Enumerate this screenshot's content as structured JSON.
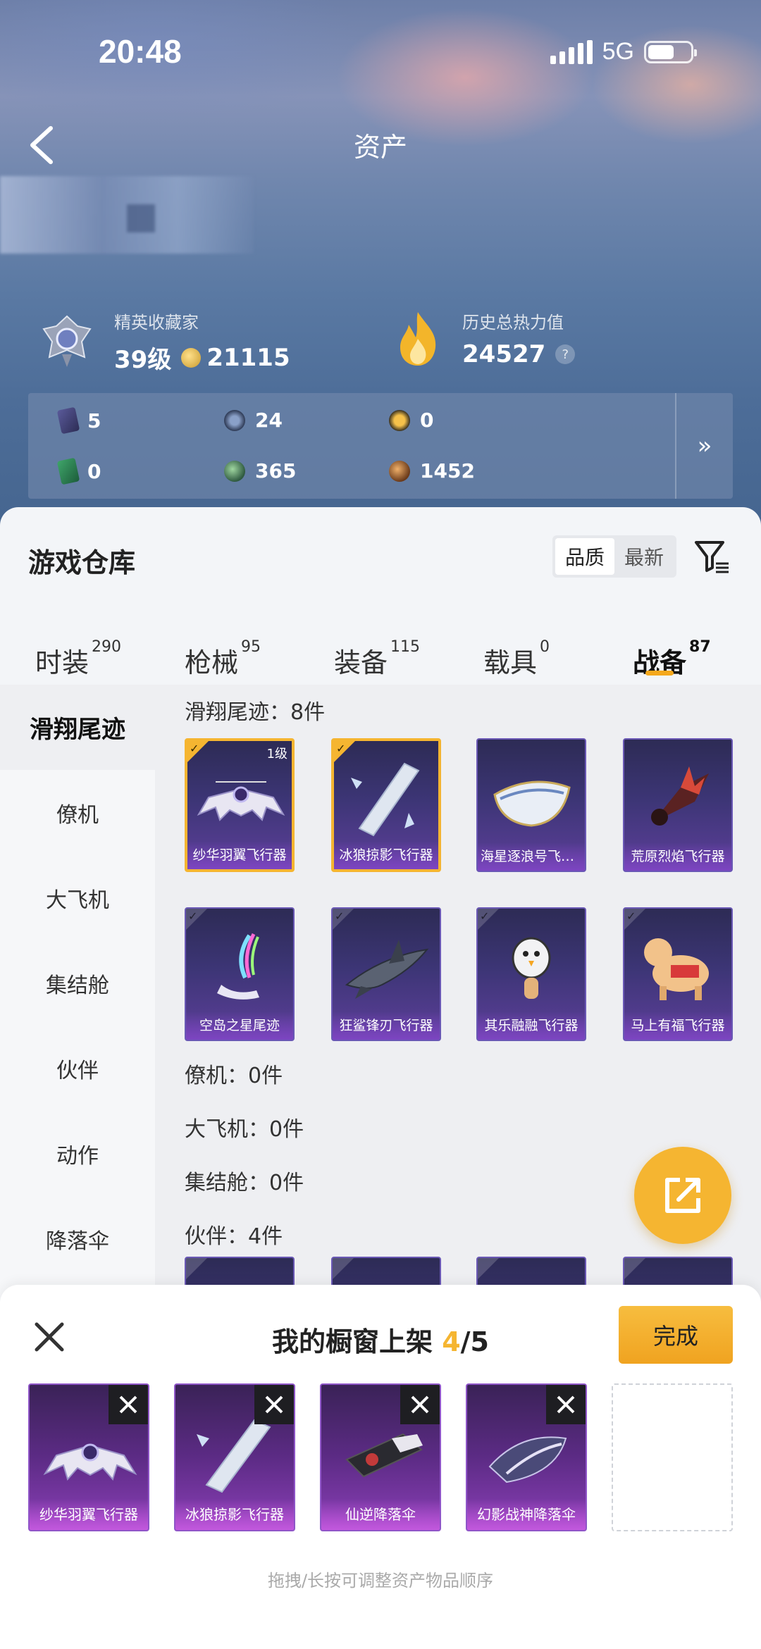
{
  "status_bar": {
    "time": "20:48",
    "network": "5G"
  },
  "header": {
    "title": "资产"
  },
  "profile": {
    "collector_label": "精英收藏家",
    "level": "39级",
    "coins": "21115",
    "power_label": "历史总热力值",
    "power_value": "24527",
    "help": "?"
  },
  "resources": {
    "row1": [
      "5",
      "24",
      "0"
    ],
    "row2": [
      "0",
      "365",
      "1452"
    ],
    "more": "»"
  },
  "warehouse": {
    "title": "游戏仓库",
    "sort_options": [
      "品质",
      "最新"
    ],
    "sort_selected": "品质",
    "tabs": [
      {
        "label": "时装",
        "count": "290"
      },
      {
        "label": "枪械",
        "count": "95"
      },
      {
        "label": "装备",
        "count": "115"
      },
      {
        "label": "载具",
        "count": "0"
      },
      {
        "label": "战备",
        "count": "87"
      }
    ],
    "active_tab": "战备",
    "sidebar": [
      "滑翔尾迹",
      "僚机",
      "大飞机",
      "集结舱",
      "伙伴",
      "动作",
      "降落伞"
    ],
    "sections": [
      {
        "title": "滑翔尾迹：8件"
      },
      {
        "title": "僚机：0件"
      },
      {
        "title": "大飞机：0件"
      },
      {
        "title": "集结舱：0件"
      },
      {
        "title": "伙伴：4件"
      }
    ],
    "items": [
      {
        "name": "纱华羽翼飞行器",
        "level": "1级",
        "selected": true
      },
      {
        "name": "冰狼掠影飞行器",
        "selected": true
      },
      {
        "name": "海星逐浪号飞行器",
        "selected": false
      },
      {
        "name": "荒原烈焰飞行器",
        "selected": false
      },
      {
        "name": "空岛之星尾迹",
        "selected": false
      },
      {
        "name": "狂鲨锋刃飞行器",
        "selected": false
      },
      {
        "name": "其乐融融飞行器",
        "selected": false
      },
      {
        "name": "马上有福飞行器",
        "selected": false
      }
    ]
  },
  "showcase": {
    "title_prefix": "我的橱窗上架 ",
    "current": "4",
    "total": "/5",
    "done_label": "完成",
    "slots": [
      "纱华羽翼飞行器",
      "冰狼掠影飞行器",
      "仙逆降落伞",
      "幻影战神降落伞"
    ],
    "hint": "拖拽/长按可调整资产物品顺序"
  },
  "colors": {
    "accent": "#f5b531",
    "card_purple": "#3c3575"
  }
}
